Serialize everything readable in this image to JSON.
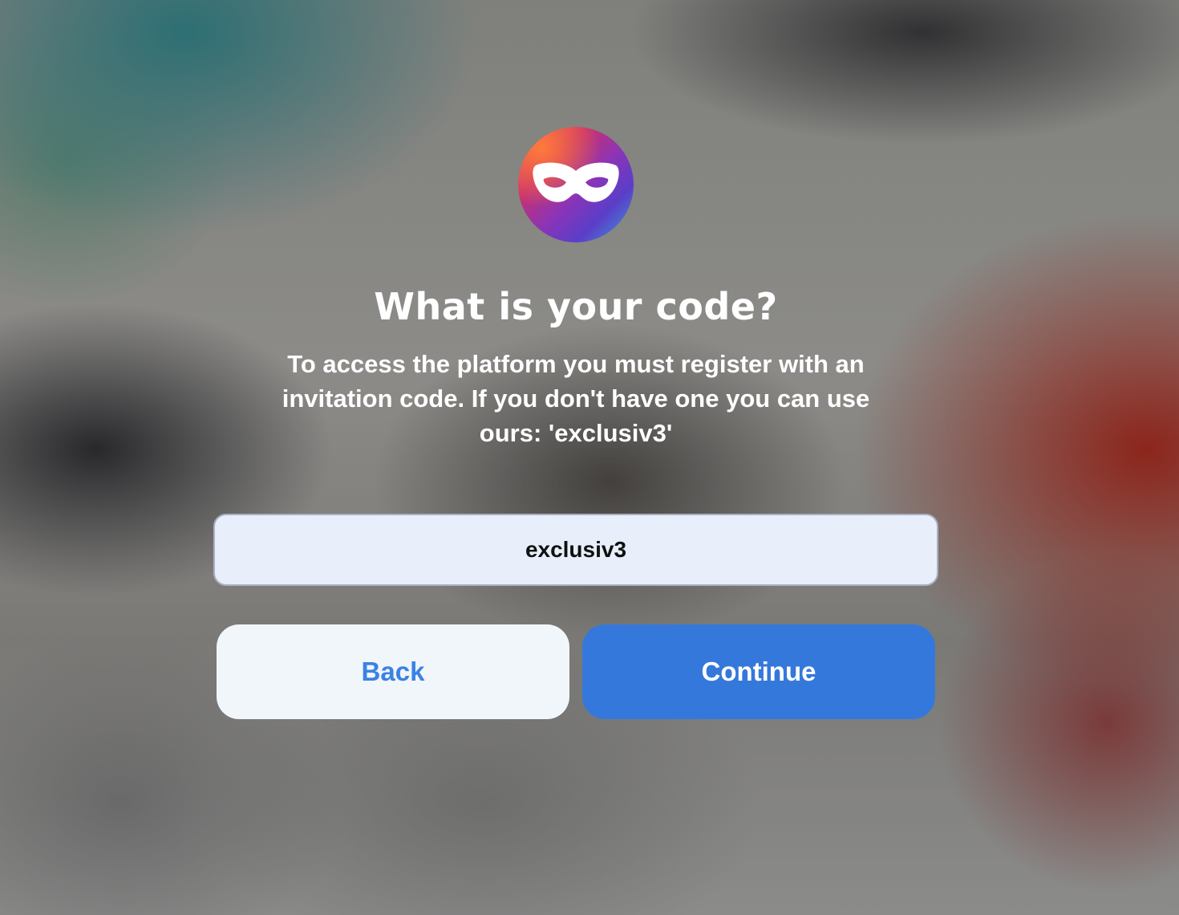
{
  "logo": {
    "icon": "mask-icon",
    "gradient_colors": [
      "#f25a4a",
      "#c8306f",
      "#8a34b8",
      "#5a3ec8",
      "#3aa2d8"
    ]
  },
  "heading": {
    "title": "What is your code?",
    "description": "To access the platform you must register with an invitation code. If you don't have one you can use ours: 'exclusiv3'"
  },
  "code_input": {
    "value": "exclusiv3"
  },
  "actions": {
    "back_label": "Back",
    "continue_label": "Continue"
  },
  "colors": {
    "primary": "#3578db",
    "secondary_bg": "#f1f6fb",
    "secondary_text": "#3a82e4",
    "input_bg": "#e8effb"
  }
}
